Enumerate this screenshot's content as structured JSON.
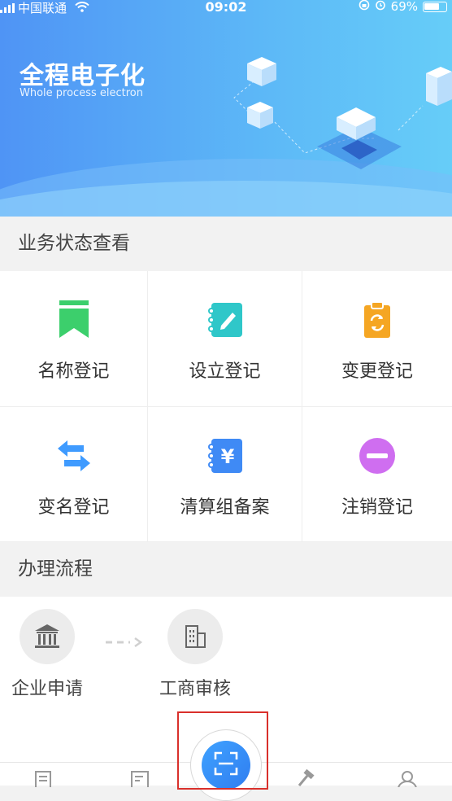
{
  "status": {
    "carrier": "中国联通",
    "time": "09:02",
    "battery": "69%"
  },
  "hero": {
    "title": "全程电子化",
    "subtitle": "Whole process electron"
  },
  "section1": {
    "title": "业务状态查看"
  },
  "services": [
    {
      "label": "名称登记",
      "icon": "bookmark-icon",
      "color": "#3ccf6c"
    },
    {
      "label": "设立登记",
      "icon": "notebook-edit-icon",
      "color": "#2fc7c9"
    },
    {
      "label": "变更登记",
      "icon": "clipboard-refresh-icon",
      "color": "#f5a623"
    },
    {
      "label": "变名登记",
      "icon": "swap-arrows-icon",
      "color": "#3f9bff"
    },
    {
      "label": "清算组备案",
      "icon": "notebook-yen-icon",
      "color": "#3f8af5"
    },
    {
      "label": "注销登记",
      "icon": "minus-circle-icon",
      "color": "#cf6ef0"
    }
  ],
  "section2": {
    "title": "办理流程"
  },
  "steps": [
    {
      "label": "企业申请",
      "icon": "bank-icon"
    },
    {
      "label": "工商审核",
      "icon": "building-icon"
    }
  ],
  "tabs": [
    "news-icon",
    "form-icon",
    "scan-icon",
    "hammer-icon",
    "user-icon"
  ]
}
